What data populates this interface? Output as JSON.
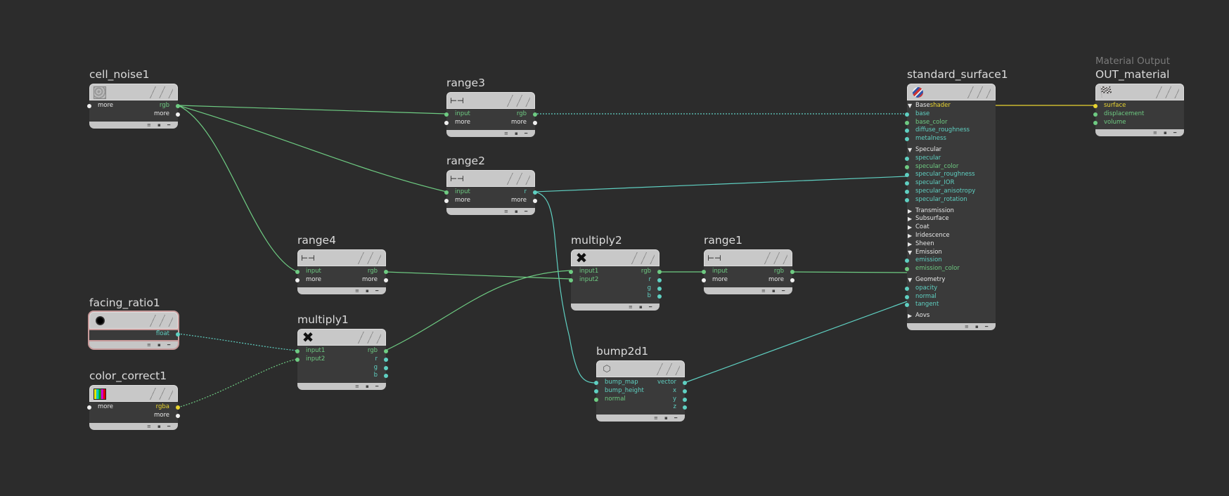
{
  "nodes": {
    "cell_noise1": {
      "title": "cell_noise1",
      "icon": "cell-noise-icon",
      "rows": [
        [
          "more",
          "rgb"
        ],
        [
          "",
          "more"
        ]
      ]
    },
    "range3": {
      "title": "range3",
      "icon": "range-icon",
      "rows": [
        [
          "input",
          "rgb"
        ],
        [
          "more",
          "more"
        ]
      ]
    },
    "range2": {
      "title": "range2",
      "icon": "range-icon",
      "rows": [
        [
          "input",
          "r"
        ],
        [
          "more",
          "more"
        ]
      ]
    },
    "range4": {
      "title": "range4",
      "icon": "range-icon",
      "rows": [
        [
          "input",
          "rgb"
        ],
        [
          "more",
          "more"
        ]
      ]
    },
    "multiply2": {
      "title": "multiply2",
      "icon": "multiply-icon",
      "rows": [
        [
          "input1",
          "rgb"
        ],
        [
          "input2",
          "r"
        ],
        [
          "",
          "g"
        ],
        [
          "",
          "b"
        ]
      ]
    },
    "range1": {
      "title": "range1",
      "icon": "range-icon",
      "rows": [
        [
          "input",
          "rgb"
        ],
        [
          "more",
          "more"
        ]
      ]
    },
    "facing_ratio1": {
      "title": "facing_ratio1",
      "icon": "facing-ratio-icon",
      "rows": [
        [
          "",
          "float"
        ]
      ]
    },
    "multiply1": {
      "title": "multiply1",
      "icon": "multiply-icon",
      "rows": [
        [
          "input1",
          "rgb"
        ],
        [
          "input2",
          "r"
        ],
        [
          "",
          "g"
        ],
        [
          "",
          "b"
        ]
      ]
    },
    "color_correct1": {
      "title": "color_correct1",
      "icon": "color-correct-icon",
      "rows": [
        [
          "more",
          "rgba"
        ],
        [
          "",
          "more"
        ]
      ]
    },
    "bump2d1": {
      "title": "bump2d1",
      "icon": "bump-icon",
      "rows": [
        [
          "bump_map",
          "vector"
        ],
        [
          "bump_height",
          "x"
        ],
        [
          "normal",
          "y"
        ],
        [
          "",
          "z"
        ]
      ]
    },
    "standard_surface1": {
      "title": "standard_surface1",
      "icon": "shader-ball-icon",
      "output": "shader",
      "sections": [
        {
          "label": "Base",
          "open": true,
          "params": [
            "base",
            "base_color",
            "diffuse_roughness",
            "metalness"
          ]
        },
        {
          "label": "Specular",
          "open": true,
          "params": [
            "specular",
            "specular_color",
            "specular_roughness",
            "specular_IOR",
            "specular_anisotropy",
            "specular_rotation"
          ]
        },
        {
          "label": "Transmission",
          "open": false,
          "params": []
        },
        {
          "label": "Subsurface",
          "open": false,
          "params": []
        },
        {
          "label": "Coat",
          "open": false,
          "params": []
        },
        {
          "label": "Iridescence",
          "open": false,
          "params": []
        },
        {
          "label": "Sheen",
          "open": false,
          "params": []
        },
        {
          "label": "Emission",
          "open": true,
          "params": [
            "emission",
            "emission_color"
          ]
        },
        {
          "label": "Geometry",
          "open": true,
          "params": [
            "opacity",
            "normal",
            "tangent"
          ]
        },
        {
          "label": "Aovs",
          "open": false,
          "params": []
        }
      ]
    },
    "OUT_material": {
      "subtitle": "Material Output",
      "title": "OUT_material",
      "icon": "checkered-flag-icon",
      "rows": [
        [
          "surface",
          ""
        ],
        [
          "displacement",
          ""
        ],
        [
          "volume",
          ""
        ]
      ]
    }
  },
  "colors": {
    "background": "#2c2c2c",
    "wire_green": "#6ecb82",
    "wire_teal": "#5fd0c2",
    "wire_yellow": "#e8d430",
    "selected_outline": "#c89b9b"
  }
}
